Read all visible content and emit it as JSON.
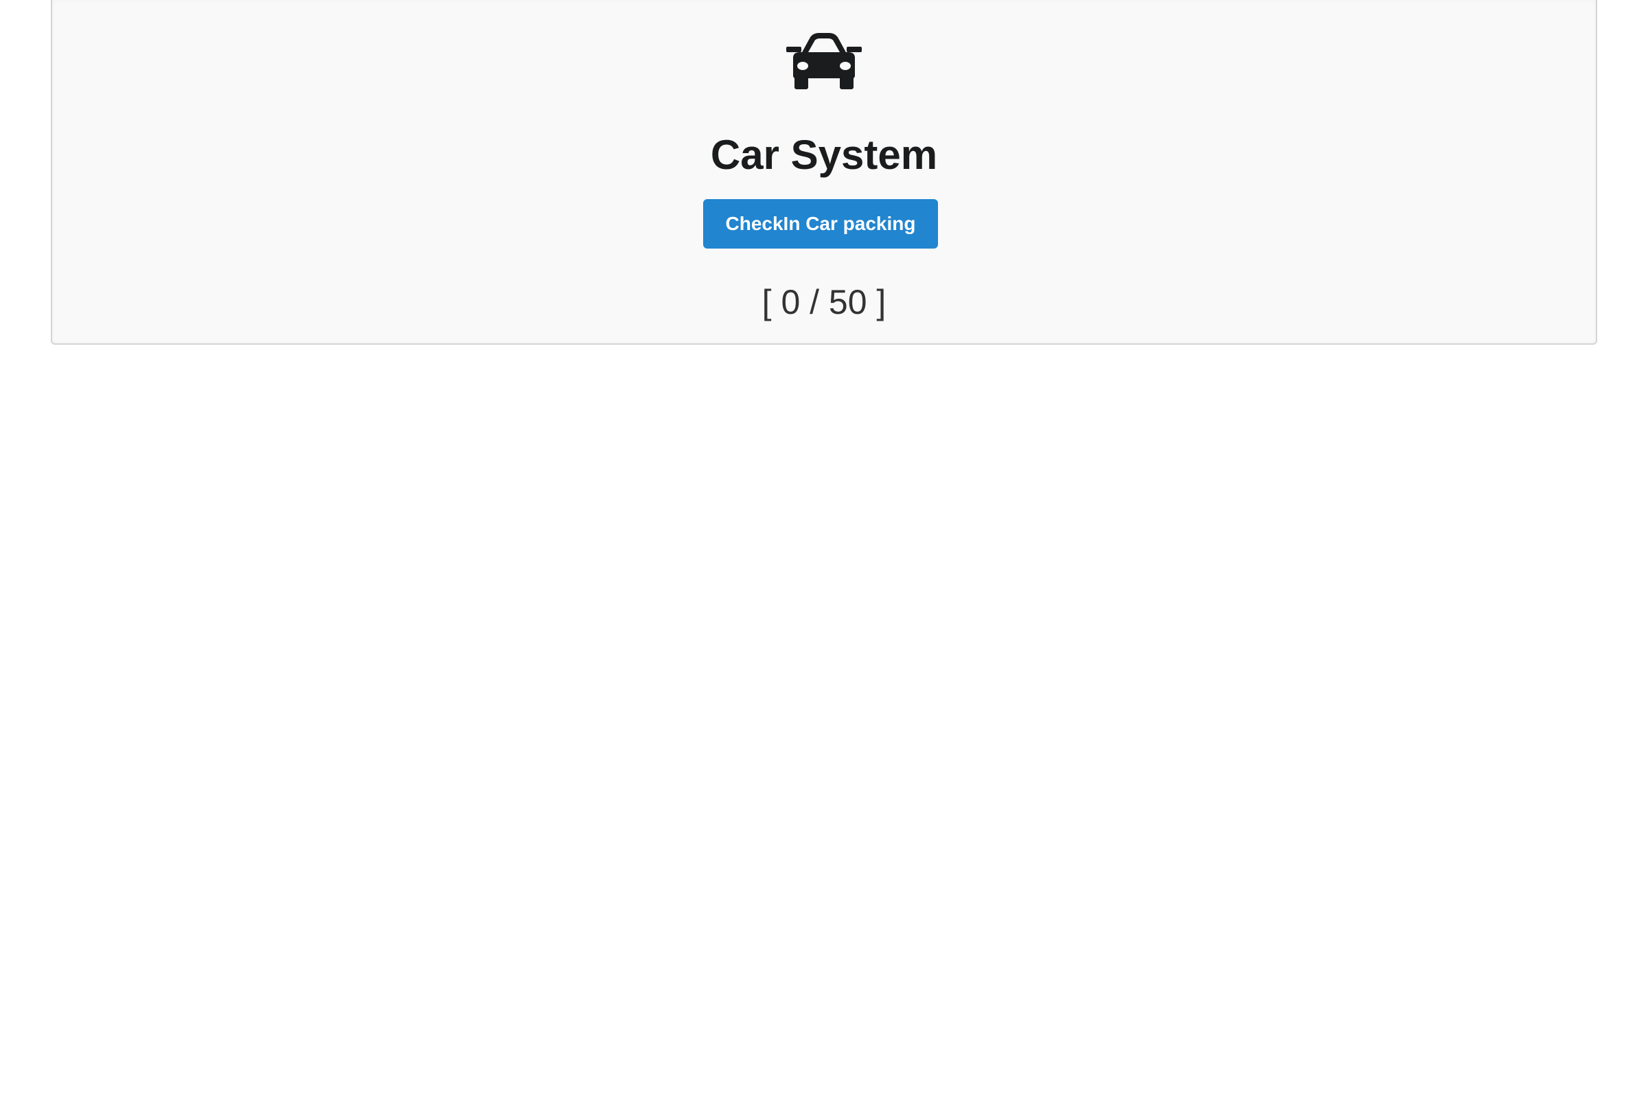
{
  "header": {
    "icon": "car-icon",
    "title": "Car System"
  },
  "actions": {
    "checkin_label": "CheckIn Car packing"
  },
  "capacity": {
    "display": "[ 0 / 50 ]",
    "occupied": 0,
    "total": 50
  },
  "colors": {
    "primary_button": "#2185d0",
    "segment_background": "#f9f9f9",
    "title_text": "#1b1c1d"
  }
}
